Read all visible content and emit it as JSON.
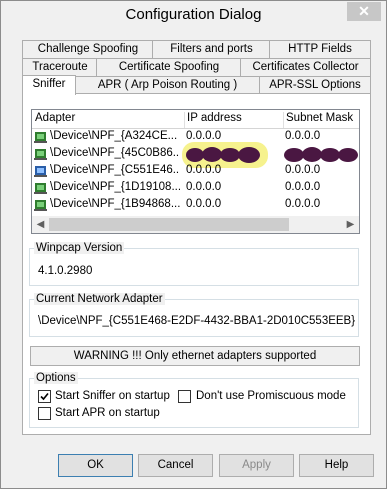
{
  "window": {
    "title": "Configuration Dialog",
    "close_glyph": "✕"
  },
  "tabs": {
    "row1": [
      "Challenge Spoofing",
      "Filters and ports",
      "HTTP Fields"
    ],
    "row2": [
      "Traceroute",
      "Certificate Spoofing",
      "Certificates Collector"
    ],
    "row3": [
      "Sniffer",
      "APR ( Arp Poison Routing )",
      "APR-SSL Options"
    ],
    "active": "Sniffer"
  },
  "adapters": {
    "columns": [
      "Adapter",
      "IP address",
      "Subnet Mask"
    ],
    "rows": [
      {
        "adapter": "\\Device\\NPF_{A324CE...",
        "ip": "0.0.0.0",
        "mask": "0.0.0.0",
        "icon": "network-card-icon"
      },
      {
        "adapter": "\\Device\\NPF_{45C0B86...",
        "ip": "",
        "mask": "",
        "icon": "network-card-icon",
        "redacted": true
      },
      {
        "adapter": "\\Device\\NPF_{C551E46...",
        "ip": "0.0.0.0",
        "mask": "0.0.0.0",
        "icon": "network-card-selected-icon"
      },
      {
        "adapter": "\\Device\\NPF_{1D19108...",
        "ip": "0.0.0.0",
        "mask": "0.0.0.0",
        "icon": "network-card-icon"
      },
      {
        "adapter": "\\Device\\NPF_{1B94868...",
        "ip": "0.0.0.0",
        "mask": "0.0.0.0",
        "icon": "network-card-icon"
      }
    ]
  },
  "winpcap": {
    "label": "Winpcap Version",
    "value": "4.1.0.2980"
  },
  "current_adapter": {
    "label": "Current Network Adapter",
    "value": "\\Device\\NPF_{C551E468-E2DF-4432-BBA1-2D010C553EEB}"
  },
  "warning": "WARNING !!! Only ethernet adapters supported",
  "options": {
    "label": "Options",
    "start_sniffer": {
      "label": "Start Sniffer on startup",
      "checked": true
    },
    "start_apr": {
      "label": "Start APR on startup",
      "checked": false
    },
    "no_promisc": {
      "label": "Don't use Promiscuous mode",
      "checked": false
    }
  },
  "buttons": {
    "ok": "OK",
    "cancel": "Cancel",
    "apply": "Apply",
    "help": "Help"
  },
  "colors": {
    "redaction": "#4a1742",
    "highlight": "#f5f07a"
  }
}
